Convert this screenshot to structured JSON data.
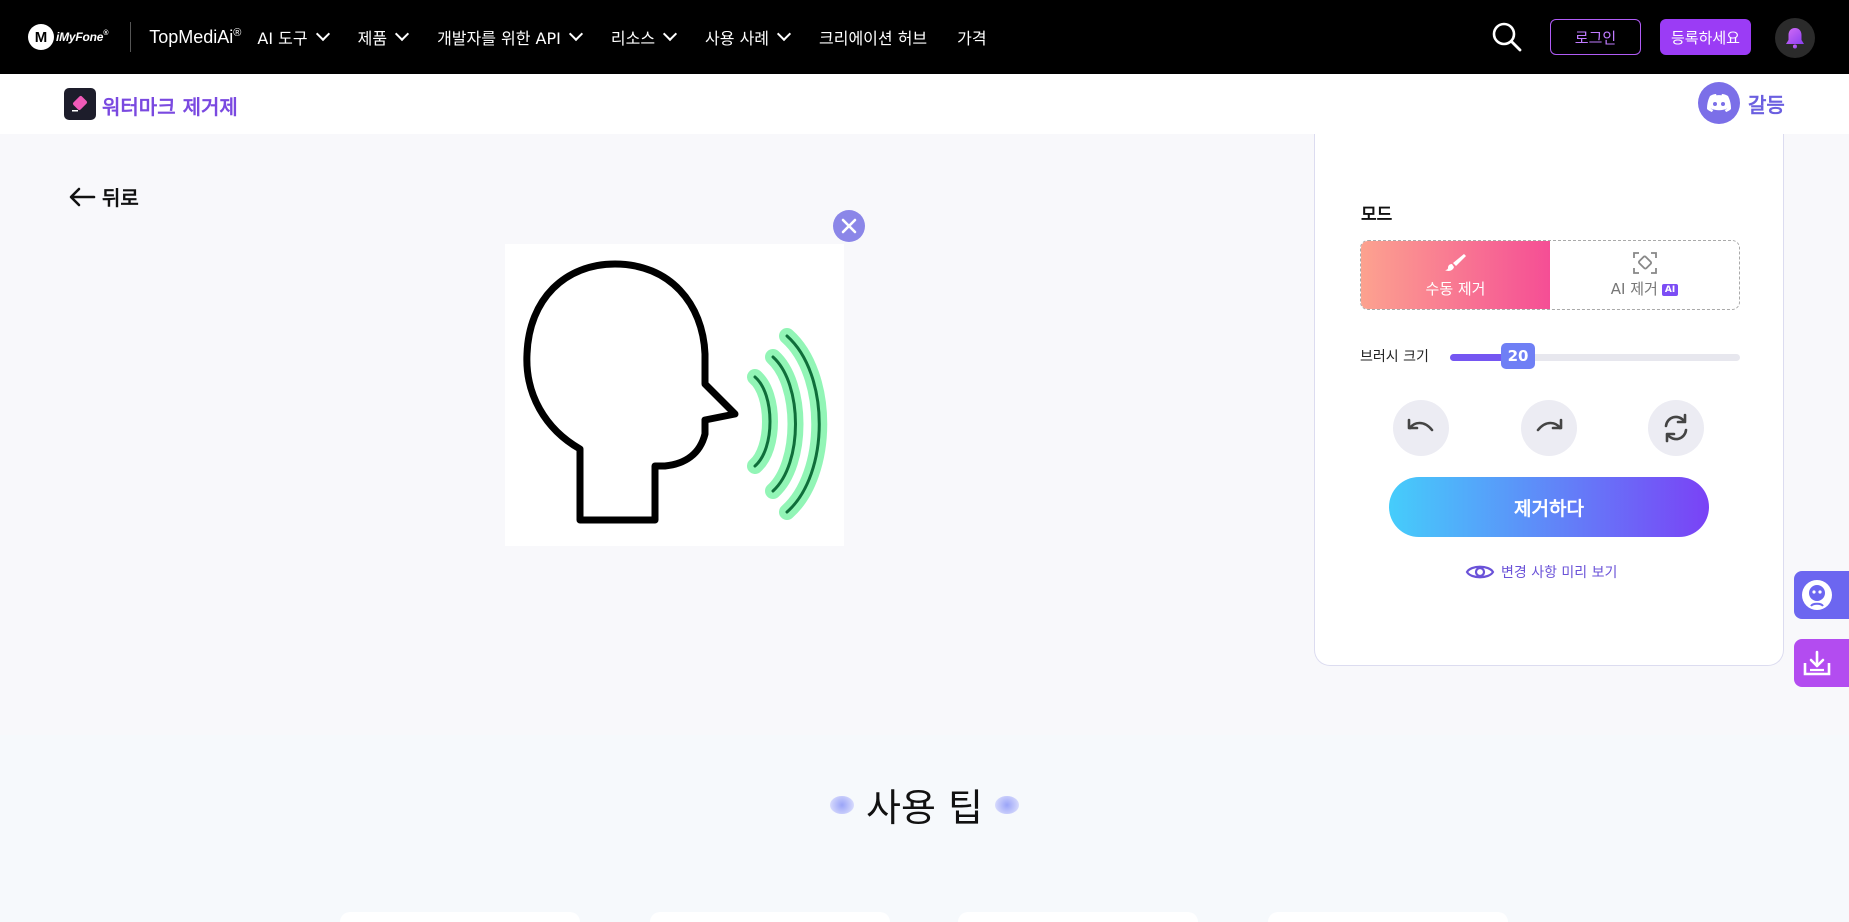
{
  "brand": {
    "logo_letter": "M",
    "name": "iMyFone",
    "reg_mark": "®",
    "product": "TopMediAi",
    "product_reg": "®"
  },
  "nav": {
    "items": [
      {
        "label": "AI 도구",
        "has_dropdown": true
      },
      {
        "label": "제품",
        "has_dropdown": true
      },
      {
        "label": "개발자를 위한 API",
        "has_dropdown": true
      },
      {
        "label": "리소스",
        "has_dropdown": true
      },
      {
        "label": "사용 사례",
        "has_dropdown": true
      },
      {
        "label": "크리에이션 허브",
        "has_dropdown": false
      },
      {
        "label": "가격",
        "has_dropdown": false
      }
    ],
    "search_icon": "search-icon",
    "login": "로그인",
    "signup": "등록하세요",
    "bell_icon": "bell-icon"
  },
  "subheader": {
    "tool_title": "워터마크 제거제",
    "discord_label": "갈등"
  },
  "main": {
    "back_label": "뒤로"
  },
  "panel": {
    "mode_label": "모드",
    "mode_manual": "수동 제거",
    "mode_ai": "AI 제거",
    "ai_tag": "AI",
    "selected_mode": "manual",
    "brush_label": "브러시 크기",
    "brush_value": "20",
    "brush_fraction": 0.2,
    "undo_icon": "undo-icon",
    "redo_icon": "redo-icon",
    "reset_icon": "reset-icon",
    "remove_button": "제거하다",
    "preview_link": "변경 사항 미리 보기"
  },
  "tips": {
    "title": "사용 팁"
  },
  "colors": {
    "accent": "#7a49e0",
    "gradient_start": "#45cdfb",
    "gradient_end": "#7a42f6",
    "manual_start": "#fca28f",
    "manual_end": "#f54e95"
  }
}
